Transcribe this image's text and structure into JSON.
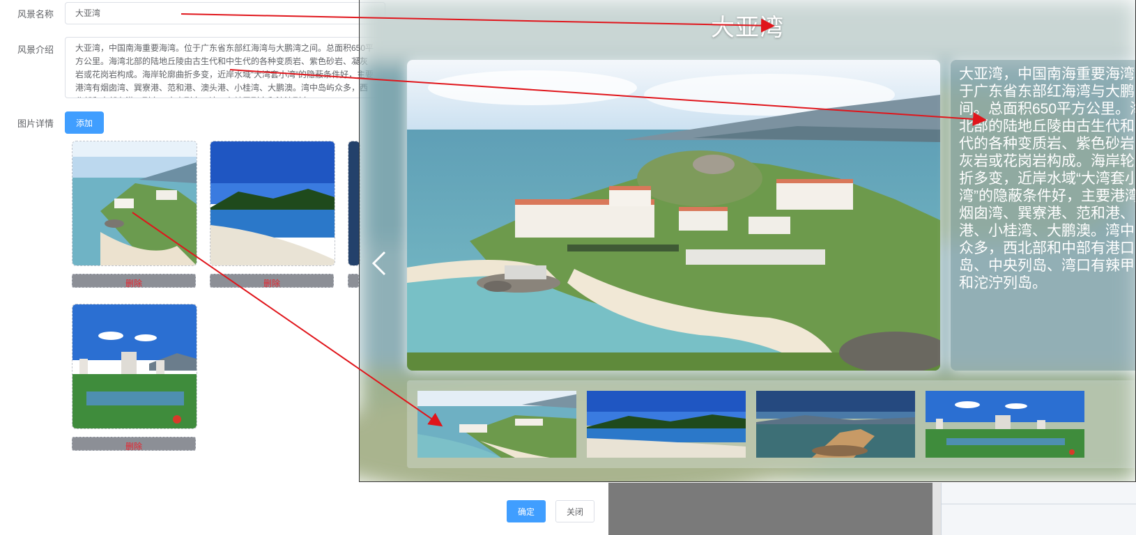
{
  "form": {
    "name_label": "风景名称",
    "name_value": "大亚湾",
    "intro_label": "风景介绍",
    "intro_value": "大亚湾，中国南海重要海湾。位于广东省东部红海湾与大鹏湾之间。总面积650平方公里。海湾北部的陆地丘陵由古生代和中生代的各种变质岩、紫色砂岩、凝灰岩或花岗岩构成。海岸轮廓曲折多变，近岸水域“大湾套小湾”的隐蔽条件好，主要港湾有烟囱湾、巽寮港、范和港、澳头港、小桂湾、大鹏澳。湾中岛屿众多，西北部和中部有港口列岛、中央列岛、湾口有辣甲列岛和沱泞列岛。",
    "pictures_label": "图片详情",
    "add_button": "添加",
    "delete_label": "删除"
  },
  "footer": {
    "confirm_button": "确定",
    "close_button": "关闭"
  },
  "viewer": {
    "title": "大亚湾",
    "description": "大亚湾，中国南海重要海湾。位于广东省东部红海湾与大鹏湾之间。总面积650平方公里。海湾北部的陆地丘陵由古生代和中生代的各种变质岩、紫色砂岩、凝灰岩或花岗岩构成。海岸轮廓曲折多变，近岸水域“大湾套小湾”的隐蔽条件好，主要港湾有烟囱湾、巽寮港、范和港、澳头港、小桂湾、大鹏澳。湾中岛屿众多，西北部和中部有港口列岛、中央列岛、湾口有辣甲列岛和沱泞列岛。",
    "prev_icon": "chevron-left-icon"
  },
  "colors": {
    "primary": "#409eff",
    "delete_text": "#e8242f",
    "annotation_arrow": "#e0151b"
  }
}
